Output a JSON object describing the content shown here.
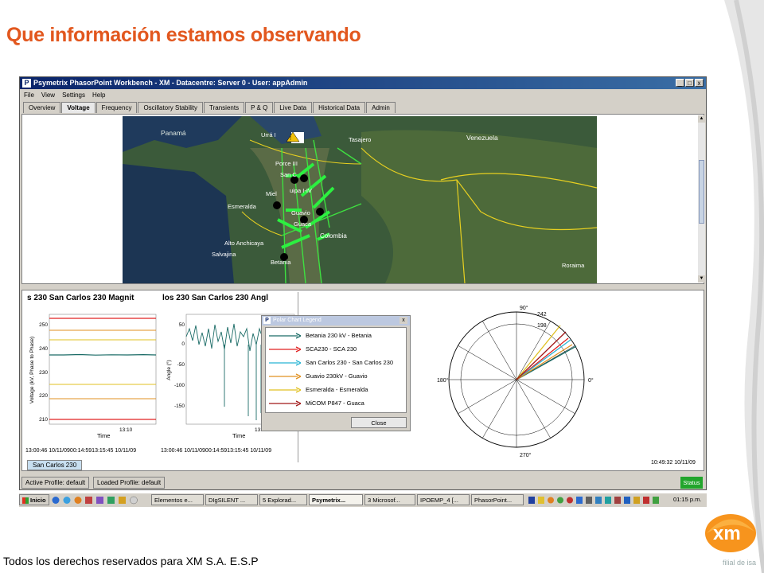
{
  "slide": {
    "title": "Que información estamos observando",
    "footer": "Todos los derechos reservados para XM S.A. E.S.P",
    "logo_text": "xm",
    "tagline": "filial de isa"
  },
  "window": {
    "title": "Psymetrix PhasorPoint Workbench - XM - Datacentre: Server 0 - User: appAdmin",
    "minimize": "_",
    "maximize": "□",
    "close": "x"
  },
  "menu": [
    "File",
    "View",
    "Settings",
    "Help"
  ],
  "tabs": [
    "Overview",
    "Voltage",
    "Frequency",
    "Oscillatory Stability",
    "Transients",
    "P & Q",
    "Live Data",
    "Historical Data",
    "Admin"
  ],
  "active_tab": "Voltage",
  "map": {
    "labels": [
      "Panamá",
      "Urrá I",
      "Tasajero",
      "Venezuela",
      "Porce III",
      "San C",
      "Miel",
      "uipa I-IV",
      "Esmeralda",
      "Guavio",
      "Guaca",
      "Colombia",
      "Alto Anchicaya",
      "Salvajina",
      "Betania",
      "Roraima"
    ]
  },
  "magnitude_chart": {
    "title": "s 230 San Carlos 230 Magnit",
    "ylabel": "Voltage (kV, Phase to Phase)",
    "xlabel": "Time",
    "yticks": [
      "250",
      "240",
      "230",
      "220",
      "210"
    ],
    "xtick": "13:10",
    "time_range": "13:00:46 10/11/0900:14:5913:15:45 10/11/09"
  },
  "angle_chart": {
    "title": "los 230 San Carlos 230 Angl",
    "ylabel": "Angle (°)",
    "xlabel": "Time",
    "yticks": [
      "50",
      "0",
      "-50",
      "-100",
      "-150"
    ],
    "xtick": "13:10",
    "time_range": "13:00:46 10/11/0900:14:5913:15:45 10/11/09"
  },
  "subtab": "San Carlos 230",
  "legend": {
    "title": "Polar Chart Legend",
    "items": [
      {
        "label": "Betania 230 kV - Betania",
        "color": "#1a6b66"
      },
      {
        "label": "SCA230 - SCA 230",
        "color": "#e02020"
      },
      {
        "label": "San Carlos 230 - San Carlos 230",
        "color": "#28b4d4"
      },
      {
        "label": "Guavio 230kV - Guavio",
        "color": "#e09020"
      },
      {
        "label": "Esmeralda - Esmeralda",
        "color": "#e0c020"
      },
      {
        "label": "MiCOM P847 - Guaca",
        "color": "#a01818"
      }
    ],
    "close": "Close"
  },
  "polar": {
    "top": "90°",
    "left": "180°",
    "right": "0°",
    "bottom": "270°",
    "ring_outer": "242",
    "ring_inner": "198",
    "timestamp": "10:49:32 10/11/09"
  },
  "status": {
    "active_profile": "Active Profile: default",
    "loaded_profile": "Loaded Profile: default",
    "button": "Status"
  },
  "taskbar": {
    "start": "Inicio",
    "items": [
      "Elementos e...",
      "DIgSILENT ...",
      "5 Explorad...",
      "Psymetrix...",
      "3 Microsof...",
      "IPOEMP_4 [...",
      "PhasorPoint..."
    ],
    "clock": "01:15 p.m."
  }
}
